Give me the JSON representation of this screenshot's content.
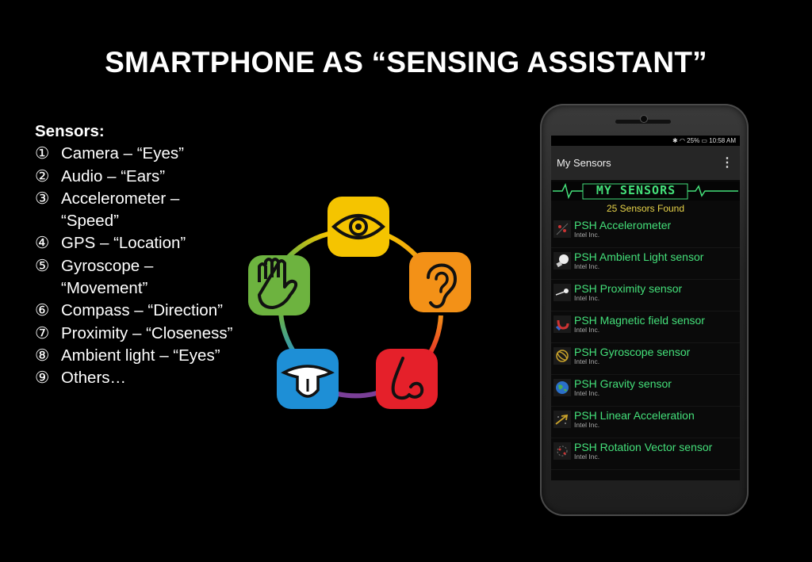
{
  "slide": {
    "title": "SMARTPHONE AS “SENSING ASSISTANT”"
  },
  "sensors": {
    "heading": "Sensors:",
    "items": [
      {
        "num": "①",
        "text": "Camera – “Eyes”"
      },
      {
        "num": "②",
        "text": "Audio – “Ears”"
      },
      {
        "num": "③",
        "text": "Accelerometer – “Speed”"
      },
      {
        "num": "④",
        "text": "GPS – “Location”"
      },
      {
        "num": "⑤",
        "text": "Gyroscope – “Movement”"
      },
      {
        "num": "⑥",
        "text": "Compass – “Direction”"
      },
      {
        "num": "⑦",
        "text": "Proximity – “Closeness”"
      },
      {
        "num": "⑧",
        "text": "Ambient light – “Eyes”"
      },
      {
        "num": "⑨",
        "text": "Others…"
      }
    ]
  },
  "senses": {
    "icons": [
      "eye-icon",
      "ear-icon",
      "nose-icon",
      "tongue-icon",
      "hand-icon"
    ],
    "colors": {
      "yellow": "#f5c400",
      "orange": "#f39117",
      "red": "#e5202a",
      "blue": "#1e8fd6",
      "green": "#6db33f",
      "purple": "#7a3f97"
    }
  },
  "phone": {
    "status": "✱ ◠ 25% ▭ 10:58 AM",
    "app_title": "My Sensors",
    "menu_icon": "⋮",
    "banner": "MY SENSORS",
    "found": "25 Sensors Found",
    "rows": [
      {
        "name": "PSH Accelerometer",
        "vendor": "Intel Inc.",
        "icon": "accelerometer-icon"
      },
      {
        "name": "PSH Ambient Light sensor",
        "vendor": "Intel Inc.",
        "icon": "bulb-icon"
      },
      {
        "name": "PSH Proximity sensor",
        "vendor": "Intel Inc.",
        "icon": "proximity-icon"
      },
      {
        "name": "PSH Magnetic field sensor",
        "vendor": "Intel Inc.",
        "icon": "magnet-icon"
      },
      {
        "name": "PSH Gyroscope sensor",
        "vendor": "Intel Inc.",
        "icon": "gyroscope-icon"
      },
      {
        "name": "PSH Gravity sensor",
        "vendor": "Intel Inc.",
        "icon": "globe-icon"
      },
      {
        "name": "PSH Linear Acceleration",
        "vendor": "Intel Inc.",
        "icon": "linear-accel-icon"
      },
      {
        "name": "PSH Rotation Vector sensor",
        "vendor": "Intel Inc.",
        "icon": "rotation-icon"
      }
    ]
  }
}
